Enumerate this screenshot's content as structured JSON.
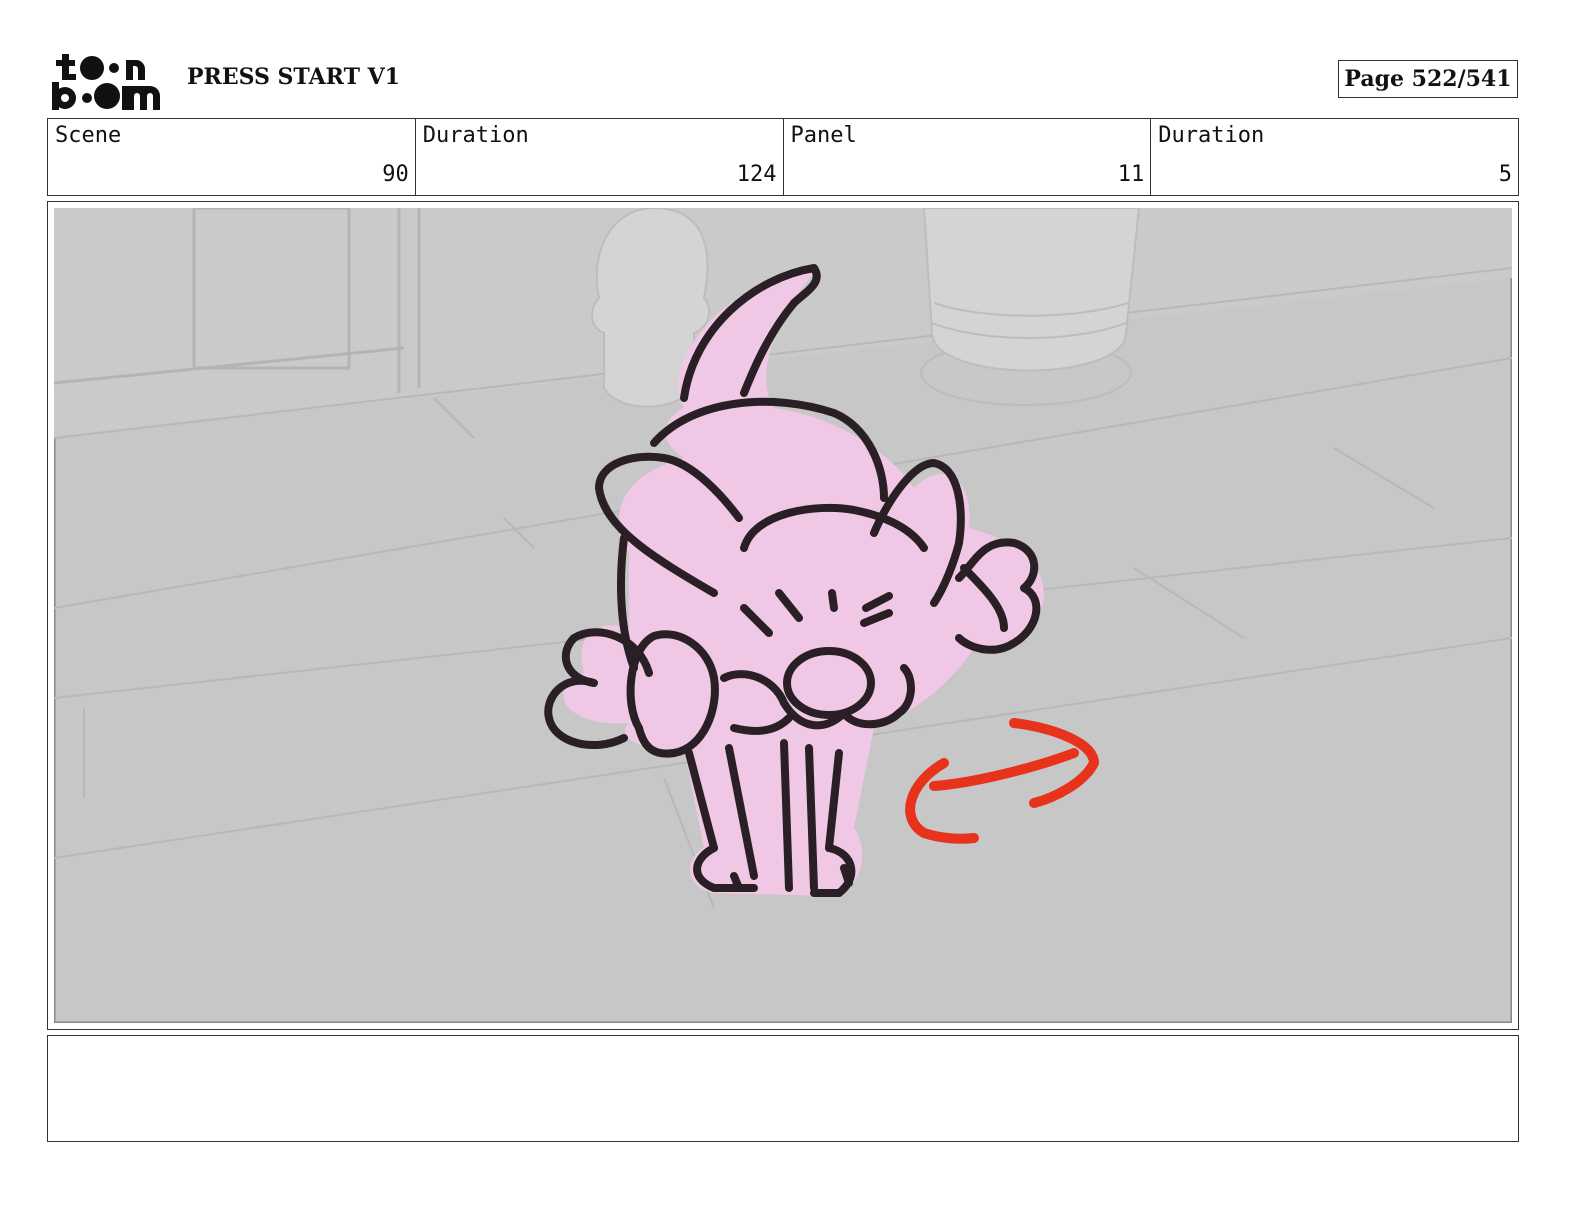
{
  "header": {
    "logo_line1": "t••n",
    "logo_line2": "b••m",
    "project_title": "PRESS START V1",
    "page_label": "Page 522/541"
  },
  "info": [
    {
      "label": "Scene",
      "value": "90"
    },
    {
      "label": "Duration",
      "value": "124"
    },
    {
      "label": "Panel",
      "value": "11"
    },
    {
      "label": "Duration",
      "value": "5"
    }
  ],
  "panel": {
    "background_color": "#c6c7c6",
    "character_fill": "#f0c8e6",
    "line_color": "#2a1f24",
    "arrow_color": "#e8331c"
  },
  "notes": {
    "text": ""
  }
}
